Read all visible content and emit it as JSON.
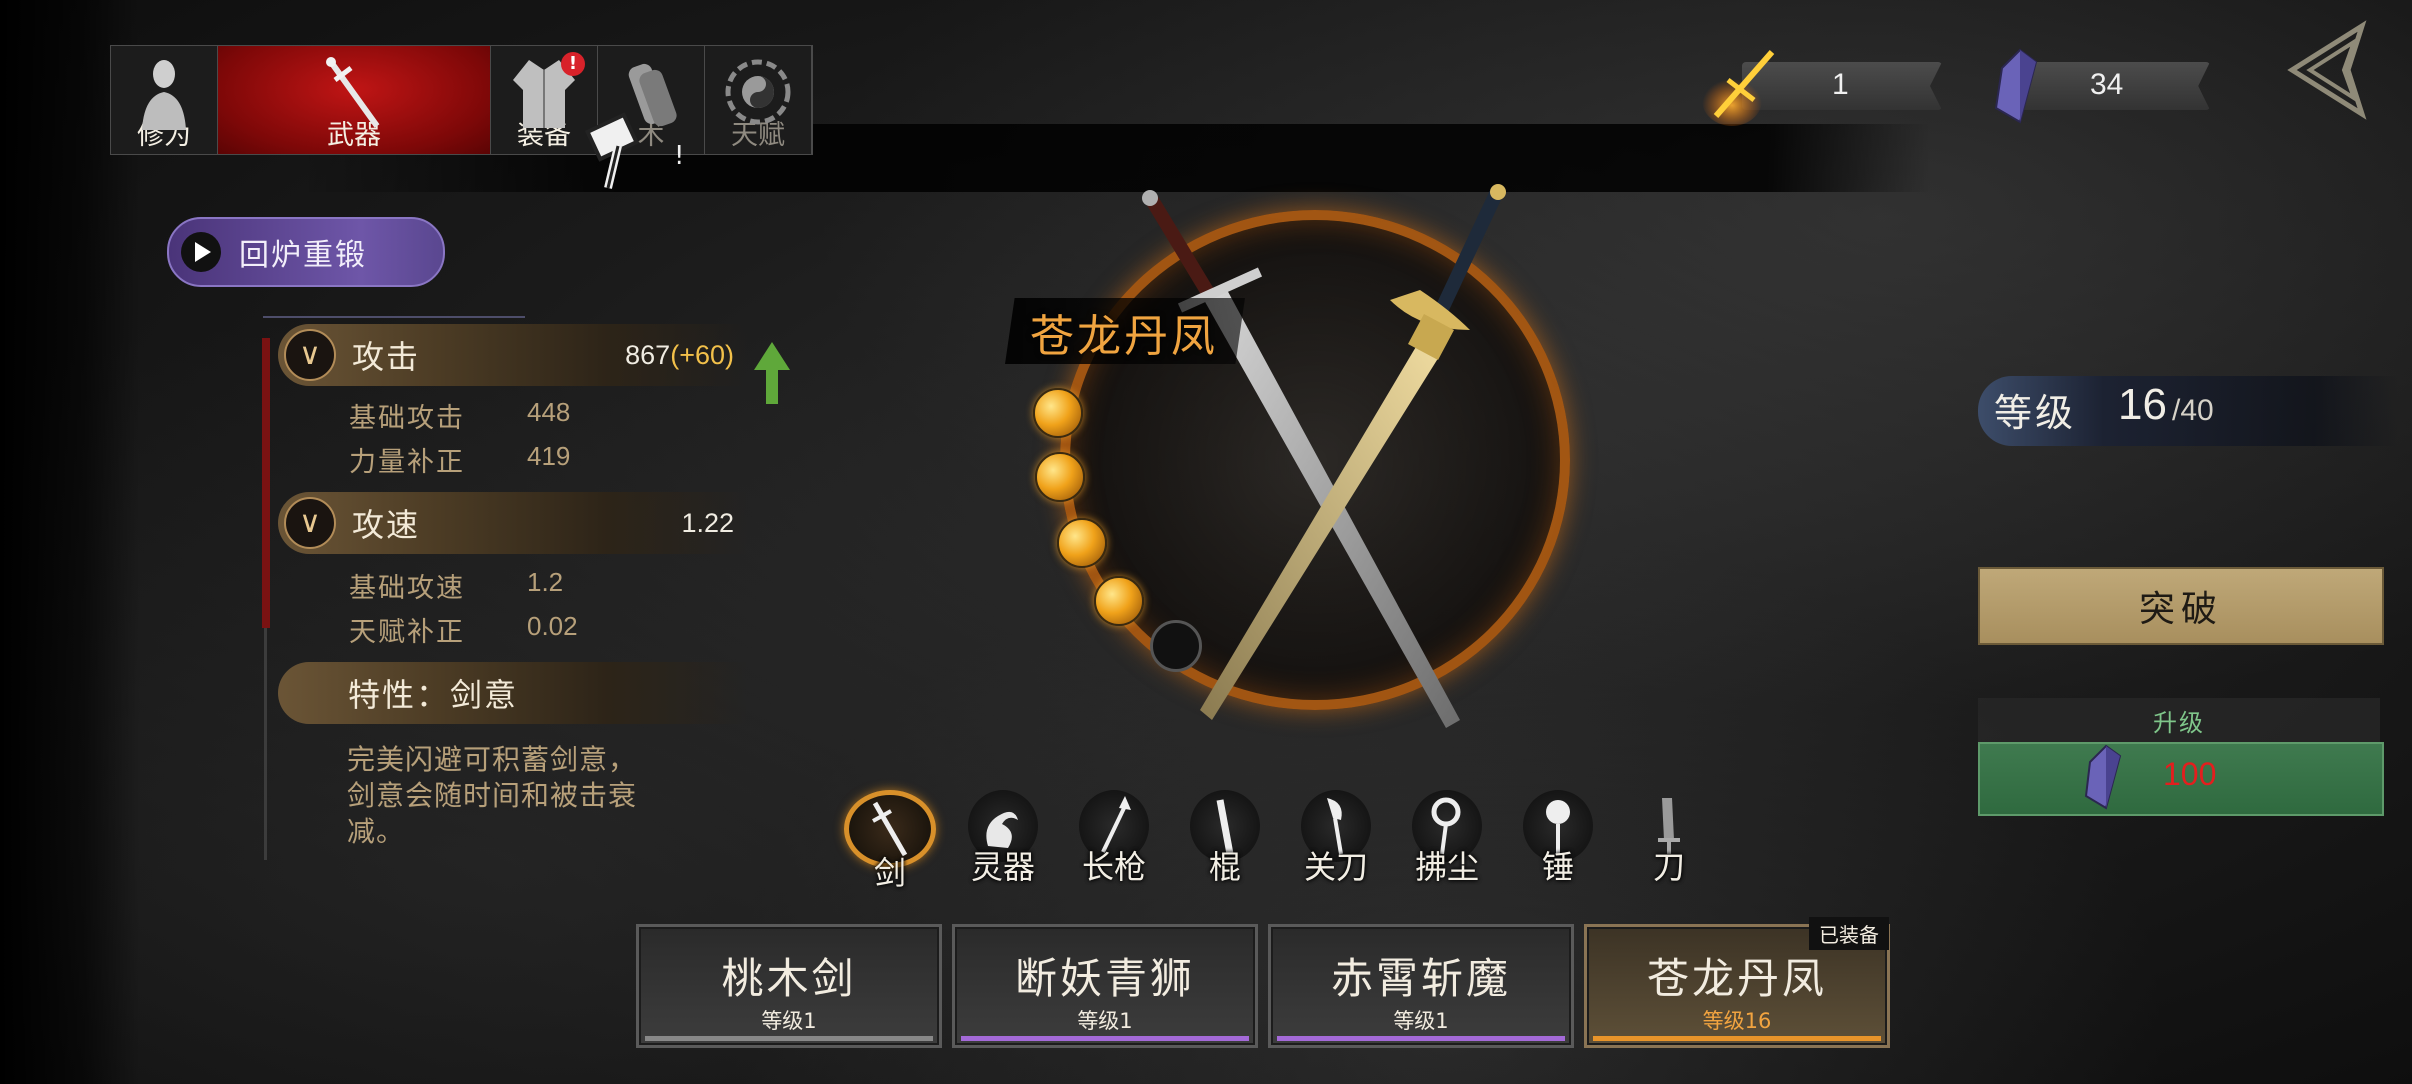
{
  "tabs": [
    {
      "label": "修为",
      "icon": "meditation-figure-icon",
      "active": false,
      "dim": false,
      "badge": ""
    },
    {
      "label": "武器",
      "icon": "sword-icon",
      "active": true,
      "dim": false,
      "badge": ""
    },
    {
      "label": "装备",
      "icon": "robe-icon",
      "active": false,
      "dim": false,
      "badge": "!"
    },
    {
      "label": "术",
      "icon": "scroll-icon",
      "active": false,
      "dim": true,
      "badge": ""
    },
    {
      "label": "天赋",
      "icon": "taiji-bagua-icon",
      "active": false,
      "dim": true,
      "badge": ""
    }
  ],
  "currencies": [
    {
      "icon": "golden-sword-token-icon",
      "value": "1"
    },
    {
      "icon": "purple-crystal-icon",
      "value": "34"
    }
  ],
  "reforge": {
    "label": "回炉重锻"
  },
  "stats": {
    "attack": {
      "title": "攻击",
      "value": "867",
      "bonus": "(+60)",
      "rows": [
        {
          "label": "基础攻击",
          "value": "448"
        },
        {
          "label": "力量补正",
          "value": "419"
        }
      ]
    },
    "speed": {
      "title": "攻速",
      "value": "1.22",
      "rows": [
        {
          "label": "基础攻速",
          "value": "1.2"
        },
        {
          "label": "天赋补正",
          "value": "0.02"
        }
      ]
    },
    "trait": {
      "title": "特性：剑意",
      "desc": "完美闪避可积蓄剑意，剑意会随时间和被击衰减。"
    }
  },
  "weapon": {
    "name": "苍龙丹凤",
    "orbs_filled": 4,
    "orbs_total": 5
  },
  "level": {
    "label": "等级",
    "current": "16",
    "max": "/40"
  },
  "breakthrough_label": "突破",
  "upgrade": {
    "label": "升级",
    "cost": "100"
  },
  "weapon_types": [
    {
      "label": "剑",
      "icon": "sword-type-icon",
      "active": true
    },
    {
      "label": "灵器",
      "icon": "dragon-spirit-icon",
      "active": false
    },
    {
      "label": "长枪",
      "icon": "spear-icon",
      "active": false
    },
    {
      "label": "棍",
      "icon": "staff-icon",
      "active": false
    },
    {
      "label": "关刀",
      "icon": "guandao-icon",
      "active": false
    },
    {
      "label": "拂尘",
      "icon": "whisk-icon",
      "active": false
    },
    {
      "label": "锤",
      "icon": "hammer-icon",
      "active": false
    },
    {
      "label": "刀",
      "icon": "saber-icon",
      "active": false
    }
  ],
  "weapon_cards": [
    {
      "name": "桃木剑",
      "level": "等级1",
      "bar_color": "#888888",
      "equipped": false
    },
    {
      "name": "断妖青狮",
      "level": "等级1",
      "bar_color": "#a46ad8",
      "equipped": false
    },
    {
      "name": "赤霄斩魔",
      "level": "等级1",
      "bar_color": "#a46ad8",
      "equipped": false
    },
    {
      "name": "苍龙丹凤",
      "level": "等级16",
      "bar_color": "#e8942a",
      "equipped": true,
      "tag": "已装备"
    }
  ],
  "colors": {
    "accent_red": "#b01212",
    "gold": "#f0a440",
    "upgrade_green": "#3f7a4f",
    "cost_red": "#e41e1e"
  }
}
